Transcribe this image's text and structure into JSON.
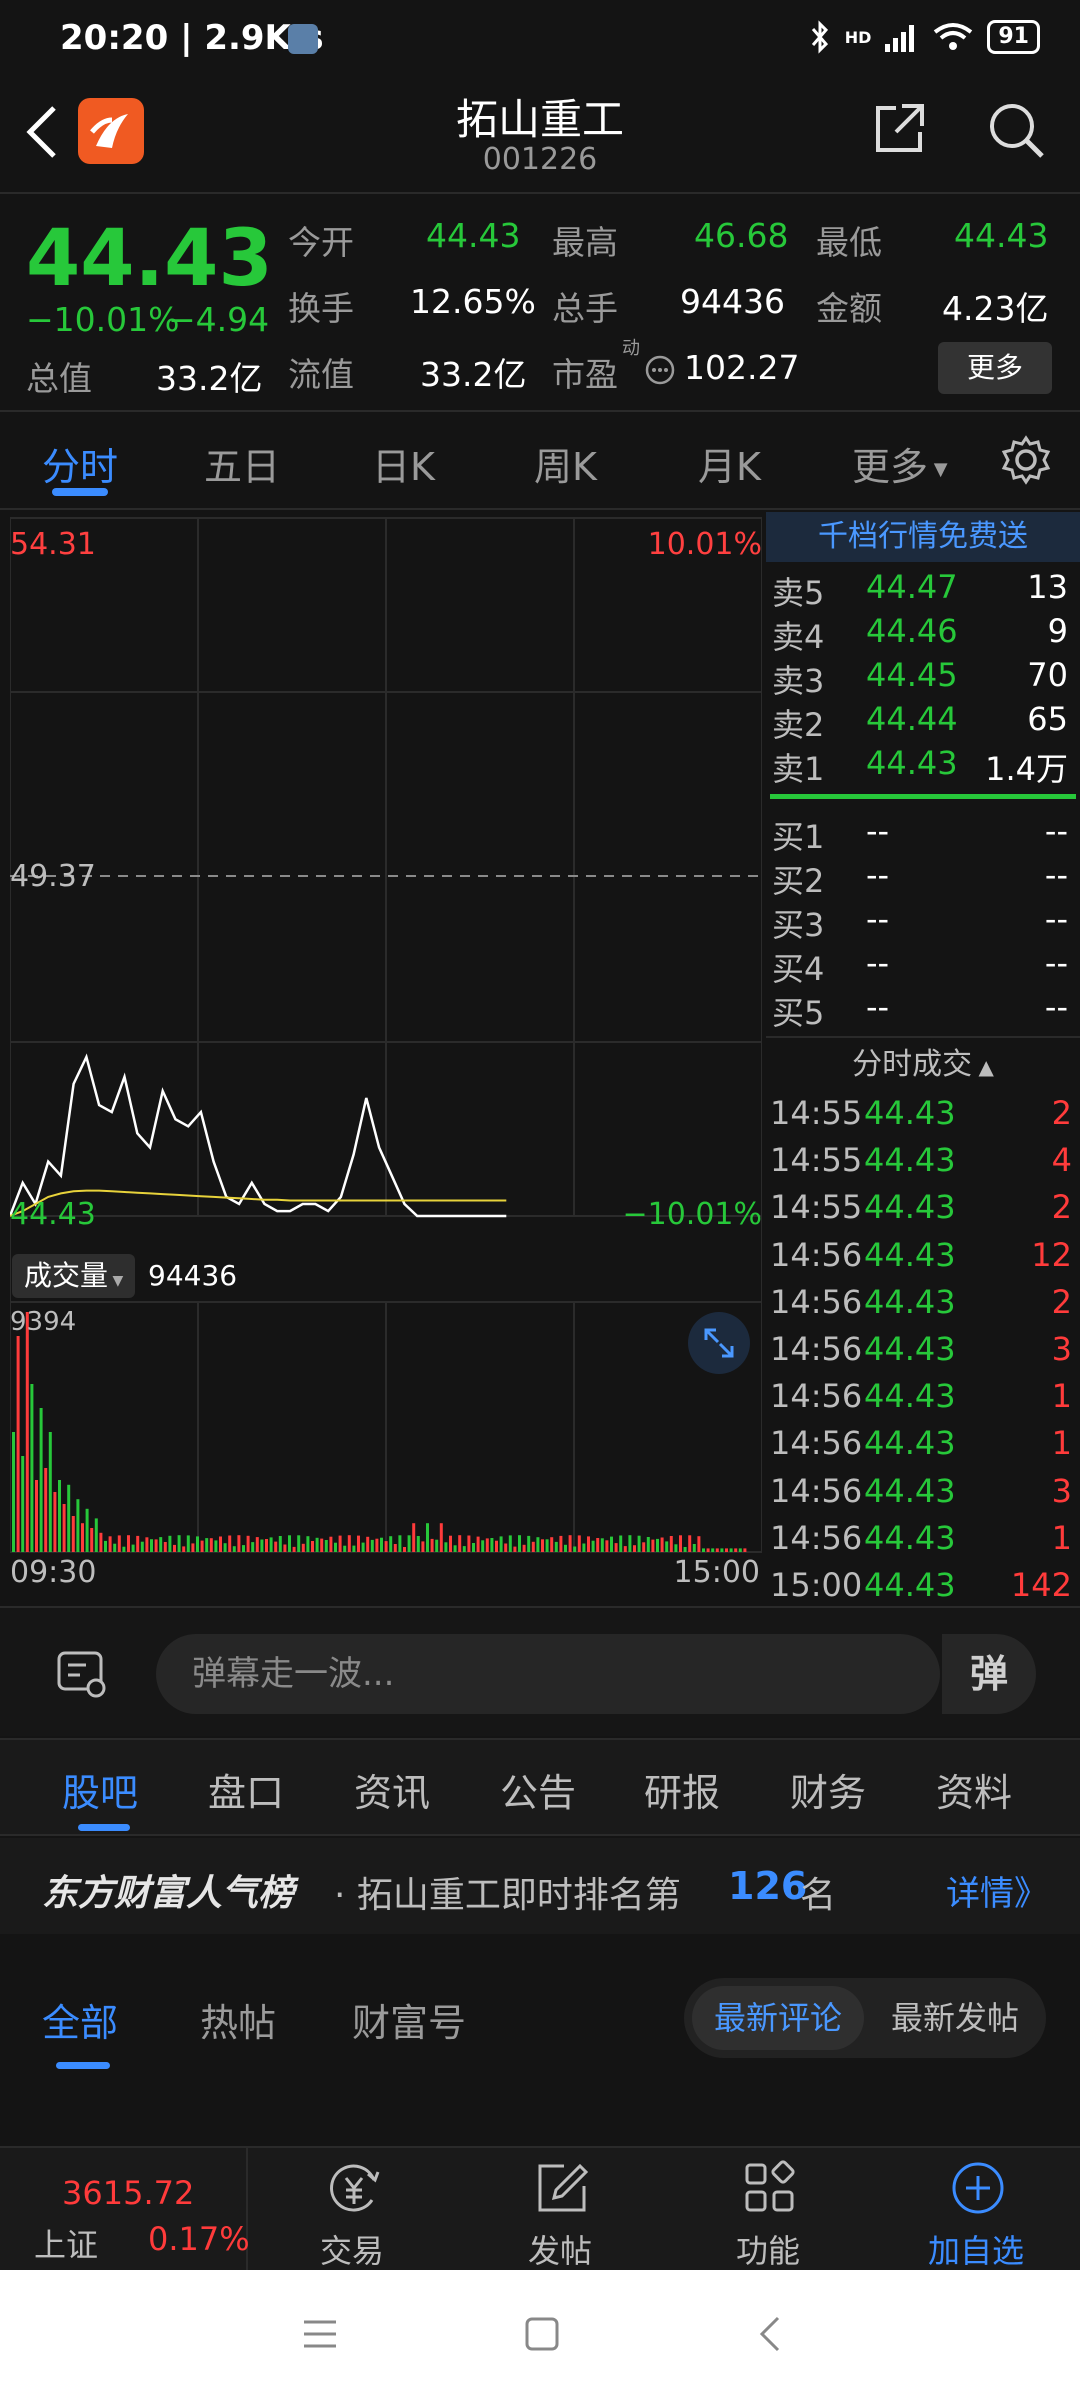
{
  "status": {
    "time": "20:20 | 2.9K/s",
    "network": "HD",
    "battery": "91"
  },
  "header": {
    "title": "拓山重工",
    "code": "001226"
  },
  "quote": {
    "price": "44.43",
    "change_pct": "−10.01%",
    "change": "−4.94",
    "open_label": "今开",
    "open": "44.43",
    "high_label": "最高",
    "high": "46.68",
    "low_label": "最低",
    "low": "44.43",
    "turnover_label": "换手",
    "turnover": "12.65%",
    "volume_label": "总手",
    "volume": "94436",
    "amount_label": "金额",
    "amount": "4.23亿",
    "mktcap_label": "总值",
    "mktcap": "33.2亿",
    "float_label": "流值",
    "float": "33.2亿",
    "pe_label": "市盈",
    "pe_sup": "动",
    "pe": "102.27",
    "more": "更多"
  },
  "tabs": [
    "分时",
    "五日",
    "日K",
    "周K",
    "月K",
    "更多"
  ],
  "chart": {
    "ymax": "54.31",
    "ymax_pct": "10.01%",
    "ymid": "49.37",
    "ymin": "44.43",
    "ymin_pct": "−10.01%",
    "vol_label": "成交量",
    "vol_value": "94436",
    "vol_max": "9394",
    "time_start": "09:30",
    "time_end": "15:00"
  },
  "chart_data": {
    "type": "line",
    "title": "",
    "ylim": [
      44.43,
      54.31
    ],
    "x_range": [
      "09:30",
      "15:00"
    ],
    "series": [
      {
        "values": [
          44.43,
          44.9,
          44.6,
          45.2,
          45.0,
          46.3,
          46.68,
          46.0,
          45.9,
          46.4,
          45.6,
          45.4,
          46.2,
          45.8,
          45.7,
          45.9,
          45.2,
          44.7,
          44.6,
          44.9,
          44.6,
          44.5,
          44.5,
          44.6,
          44.6,
          44.5,
          44.7,
          45.3,
          46.1,
          45.4,
          45.0,
          44.6,
          44.43,
          44.43,
          44.43,
          44.43,
          44.43,
          44.43,
          44.43,
          44.43
        ]
      },
      {
        "values": [
          44.43,
          44.5,
          44.6,
          44.7,
          44.75,
          44.78,
          44.79,
          44.79,
          44.78,
          44.77,
          44.76,
          44.75,
          44.74,
          44.73,
          44.72,
          44.71,
          44.7,
          44.69,
          44.68,
          44.67,
          44.66,
          44.66,
          44.65,
          44.65,
          44.65,
          44.65,
          44.65,
          44.65,
          44.65,
          44.65,
          44.65,
          44.65,
          44.65,
          44.65,
          44.65,
          44.65,
          44.65,
          44.65,
          44.65,
          44.65
        ]
      }
    ]
  },
  "side": {
    "free": "千档行情免费送",
    "sells": [
      {
        "label": "卖5",
        "price": "44.47",
        "vol": "13"
      },
      {
        "label": "卖4",
        "price": "44.46",
        "vol": "9"
      },
      {
        "label": "卖3",
        "price": "44.45",
        "vol": "70"
      },
      {
        "label": "卖2",
        "price": "44.44",
        "vol": "65"
      },
      {
        "label": "卖1",
        "price": "44.43",
        "vol": "1.4万"
      }
    ],
    "buys": [
      {
        "label": "买1",
        "price": "--",
        "vol": "--"
      },
      {
        "label": "买2",
        "price": "--",
        "vol": "--"
      },
      {
        "label": "买3",
        "price": "--",
        "vol": "--"
      },
      {
        "label": "买4",
        "price": "--",
        "vol": "--"
      },
      {
        "label": "买5",
        "price": "--",
        "vol": "--"
      }
    ],
    "trades_title": "分时成交",
    "trades": [
      {
        "time": "14:55",
        "price": "44.43",
        "vol": "2"
      },
      {
        "time": "14:55",
        "price": "44.43",
        "vol": "4"
      },
      {
        "time": "14:55",
        "price": "44.43",
        "vol": "2"
      },
      {
        "time": "14:56",
        "price": "44.43",
        "vol": "12"
      },
      {
        "time": "14:56",
        "price": "44.43",
        "vol": "2"
      },
      {
        "time": "14:56",
        "price": "44.43",
        "vol": "3"
      },
      {
        "time": "14:56",
        "price": "44.43",
        "vol": "1"
      },
      {
        "time": "14:56",
        "price": "44.43",
        "vol": "1"
      },
      {
        "time": "14:56",
        "price": "44.43",
        "vol": "3"
      },
      {
        "time": "14:56",
        "price": "44.43",
        "vol": "1"
      },
      {
        "time": "15:00",
        "price": "44.43",
        "vol": "142"
      }
    ]
  },
  "danmaku": {
    "placeholder": "弹幕走一波...",
    "btn": "弹"
  },
  "sectabs": [
    "股吧",
    "盘口",
    "资讯",
    "公告",
    "研报",
    "财务",
    "资料"
  ],
  "rank": {
    "brand": "东方财富人气榜",
    "text": "· 拓山重工即时排名第",
    "rank": "126",
    "suffix": "名",
    "detail": "详情》"
  },
  "filter": {
    "all": "全部",
    "hot": "热帖",
    "wealth": "财富号",
    "latest_comment": "最新评论",
    "latest_post": "最新发帖"
  },
  "bottom": {
    "index_value": "3615.72",
    "index_name": "上证",
    "index_pct": "0.17%",
    "trade": "交易",
    "post": "发帖",
    "func": "功能",
    "add": "加自选"
  }
}
